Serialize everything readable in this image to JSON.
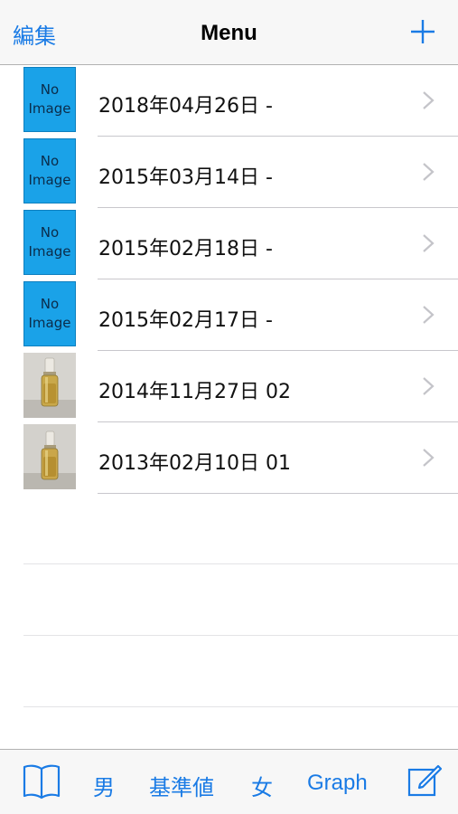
{
  "navbar": {
    "edit_label": "編集",
    "title": "Menu",
    "add_icon": "plus-icon"
  },
  "records": [
    {
      "label": "2018年04月26日 -",
      "thumb": "no-image",
      "thumb_line1": "No",
      "thumb_line2": "Image"
    },
    {
      "label": "2015年03月14日 -",
      "thumb": "no-image",
      "thumb_line1": "No",
      "thumb_line2": "Image"
    },
    {
      "label": "2015年02月18日 -",
      "thumb": "no-image",
      "thumb_line1": "No",
      "thumb_line2": "Image"
    },
    {
      "label": "2015年02月17日 -",
      "thumb": "no-image",
      "thumb_line1": "No",
      "thumb_line2": "Image"
    },
    {
      "label": "2014年11月27日 02",
      "thumb": "photo"
    },
    {
      "label": "2013年02月10日 01",
      "thumb": "photo"
    }
  ],
  "tabbar": {
    "book_icon": "book-icon",
    "male_label": "男",
    "standard_label": "基準値",
    "female_label": "女",
    "graph_label": "Graph",
    "compose_icon": "compose-icon"
  },
  "colors": {
    "accent": "#1a7be5",
    "no_image_bg": "#1aa2e8"
  }
}
